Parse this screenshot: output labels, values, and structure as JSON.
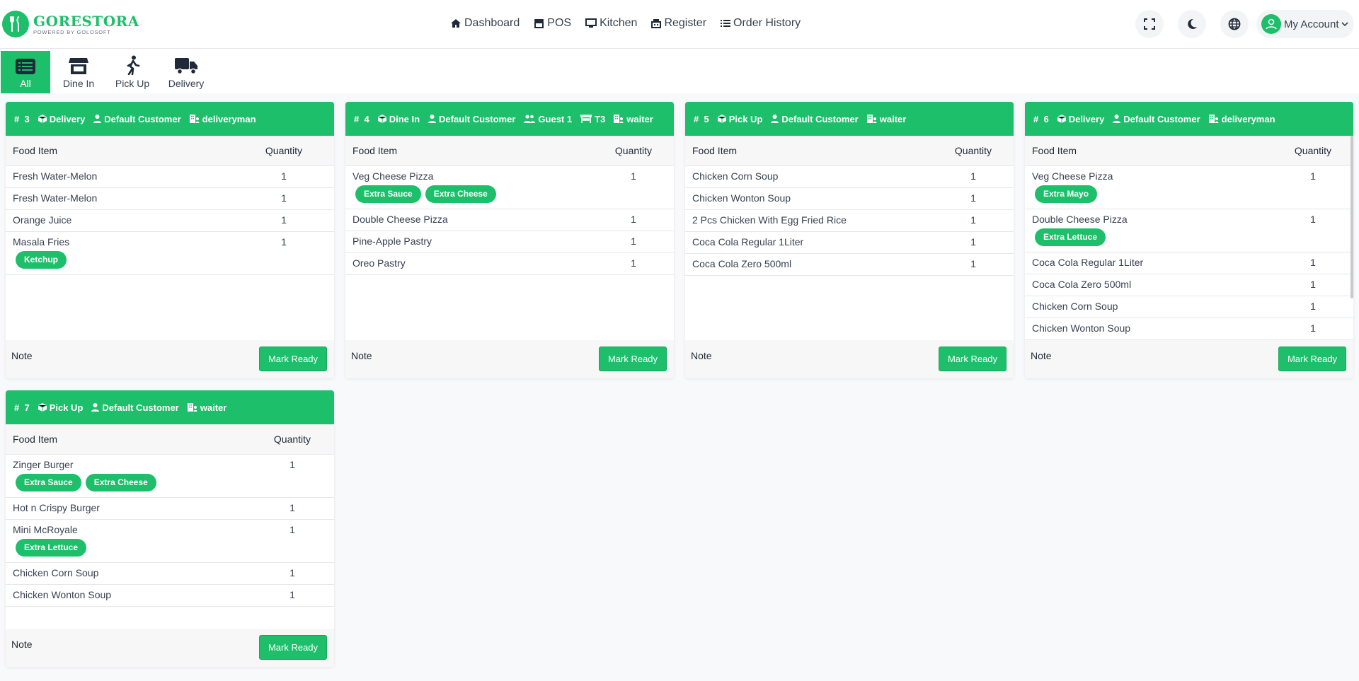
{
  "brand": {
    "name": "GORESTORA",
    "tagline": "POWERED BY GOLOSOFT",
    "color": "#1dbf6b"
  },
  "nav": {
    "dashboard": "Dashboard",
    "pos": "POS",
    "kitchen": "Kitchen",
    "register": "Register",
    "order_history": "Order History"
  },
  "header": {
    "account_label": "My Account"
  },
  "filters": {
    "all": "All",
    "dine_in": "Dine In",
    "pick_up": "Pick Up",
    "delivery": "Delivery"
  },
  "table_headers": {
    "item": "Food Item",
    "qty": "Quantity"
  },
  "actions": {
    "note": "Note",
    "mark_ready": "Mark Ready"
  },
  "orders": [
    {
      "number": "3",
      "type": "Delivery",
      "customer": "Default Customer",
      "staff": "deliveryman",
      "items": [
        {
          "name": "Fresh Water-Melon",
          "qty": "1"
        },
        {
          "name": "Fresh Water-Melon",
          "qty": "1"
        },
        {
          "name": "Orange Juice",
          "qty": "1"
        },
        {
          "name": "Masala Fries",
          "qty": "1",
          "addons": [
            "Ketchup"
          ]
        }
      ]
    },
    {
      "number": "4",
      "type": "Dine In",
      "customer": "Default Customer",
      "guest": "Guest 1",
      "table": "T3",
      "staff": "waiter",
      "items": [
        {
          "name": "Veg Cheese Pizza",
          "qty": "1",
          "addons": [
            "Extra Sauce",
            "Extra Cheese"
          ]
        },
        {
          "name": "Double Cheese Pizza",
          "qty": "1"
        },
        {
          "name": "Pine-Apple Pastry",
          "qty": "1"
        },
        {
          "name": "Oreo Pastry",
          "qty": "1"
        }
      ]
    },
    {
      "number": "5",
      "type": "Pick Up",
      "customer": "Default Customer",
      "staff": "waiter",
      "items": [
        {
          "name": "Chicken Corn Soup",
          "qty": "1"
        },
        {
          "name": "Chicken Wonton Soup",
          "qty": "1"
        },
        {
          "name": "2 Pcs Chicken With Egg Fried Rice",
          "qty": "1"
        },
        {
          "name": "Coca Cola Regular 1Liter",
          "qty": "1"
        },
        {
          "name": "Coca Cola Zero 500ml",
          "qty": "1"
        }
      ]
    },
    {
      "number": "6",
      "type": "Delivery",
      "customer": "Default Customer",
      "staff": "deliveryman",
      "items": [
        {
          "name": "Veg Cheese Pizza",
          "qty": "1",
          "addons": [
            "Extra Mayo"
          ]
        },
        {
          "name": "Double Cheese Pizza",
          "qty": "1",
          "addons": [
            "Extra Lettuce"
          ]
        },
        {
          "name": "Coca Cola Regular 1Liter",
          "qty": "1"
        },
        {
          "name": "Coca Cola Zero 500ml",
          "qty": "1"
        },
        {
          "name": "Chicken Corn Soup",
          "qty": "1"
        },
        {
          "name": "Chicken Wonton Soup",
          "qty": "1"
        }
      ]
    },
    {
      "number": "7",
      "type": "Pick Up",
      "customer": "Default Customer",
      "staff": "waiter",
      "items": [
        {
          "name": "Zinger Burger",
          "qty": "1",
          "addons": [
            "Extra Sauce",
            "Extra Cheese"
          ]
        },
        {
          "name": "Hot n Crispy Burger",
          "qty": "1"
        },
        {
          "name": "Mini McRoyale",
          "qty": "1",
          "addons": [
            "Extra Lettuce"
          ]
        },
        {
          "name": "Chicken Corn Soup",
          "qty": "1"
        },
        {
          "name": "Chicken Wonton Soup",
          "qty": "1"
        }
      ]
    }
  ]
}
